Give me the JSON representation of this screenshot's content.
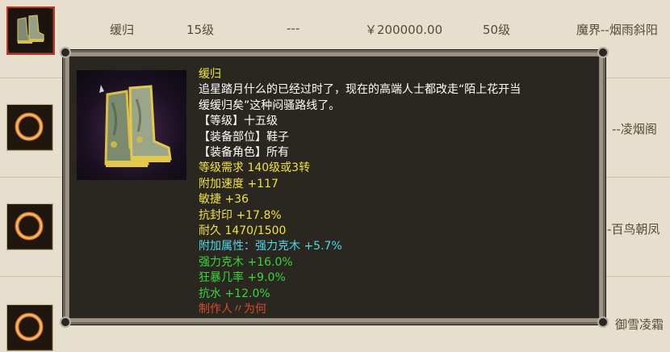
{
  "rows": [
    {
      "name": "缓归",
      "level": "15级",
      "dash": "---",
      "price": "￥200000.00",
      "req_level": "50级",
      "seller": "魔界--烟雨斜阳"
    },
    {
      "seller": "--凌烟阁"
    },
    {
      "seller": "-百鸟朝凤"
    },
    {
      "seller": "御雪凌霜"
    }
  ],
  "tooltip": {
    "name": "缓归",
    "desc_1": "追星踏月什么的已经过时了，现在的高端人士都改走“陌上花开当",
    "desc_2": "缓缓归矣”这种闷骚路线了。",
    "grade": "【等级】十五级",
    "slot": "【装备部位】鞋子",
    "role": "【装备角色】所有",
    "requirement": "等级需求 140级或3转",
    "stat_speed": "附加速度 +117",
    "stat_agility": "敏捷 +36",
    "stat_seal_resist": "抗封印 +17.8%",
    "durability": "耐久 1470/1500",
    "bonus_header": "附加属性：强力克木 +5.7%",
    "bonus_1": "强力克木 +16.0%",
    "bonus_2": "狂暴几率 +9.0%",
    "bonus_3": "抗水 +12.0%",
    "maker": "制作人〃为何"
  },
  "colors": {
    "yellow": "#f1e23d",
    "white": "#ffffff",
    "cyan": "#4fd7e8",
    "green": "#39d639",
    "red": "#d84a28"
  }
}
